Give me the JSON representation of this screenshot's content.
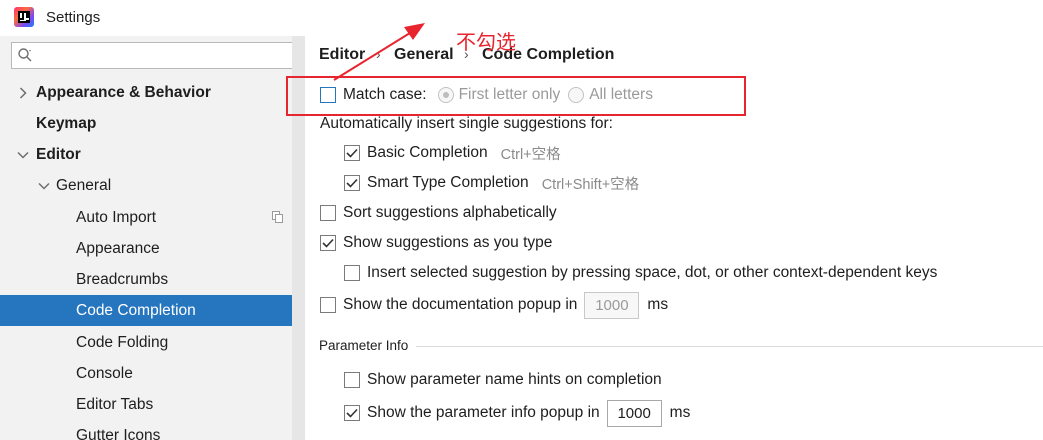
{
  "window": {
    "title": "Settings"
  },
  "sidebar": {
    "search_placeholder": "",
    "items": [
      {
        "label": "Appearance & Behavior",
        "level": 0,
        "expanded": false
      },
      {
        "label": "Keymap",
        "level": 0
      },
      {
        "label": "Editor",
        "level": 0,
        "expanded": true
      },
      {
        "label": "General",
        "level": 1,
        "expanded": true
      },
      {
        "label": "Auto Import",
        "level": 2
      },
      {
        "label": "Appearance",
        "level": 2
      },
      {
        "label": "Breadcrumbs",
        "level": 2
      },
      {
        "label": "Code Completion",
        "level": 2,
        "selected": true
      },
      {
        "label": "Code Folding",
        "level": 2
      },
      {
        "label": "Console",
        "level": 2
      },
      {
        "label": "Editor Tabs",
        "level": 2
      },
      {
        "label": "Gutter Icons",
        "level": 2
      }
    ]
  },
  "breadcrumb": [
    "Editor",
    "General",
    "Code Completion"
  ],
  "annotation": {
    "text": "不勾选",
    "color": "#e8252f"
  },
  "options": {
    "match_case": {
      "label": "Match case:",
      "checked": false
    },
    "first_letter_only": {
      "label": "First letter only",
      "selected": true,
      "enabled": false
    },
    "all_letters": {
      "label": "All letters",
      "selected": false,
      "enabled": false
    },
    "auto_insert_heading": "Automatically insert single suggestions for:",
    "basic_completion": {
      "label": "Basic Completion",
      "shortcut": "Ctrl+空格",
      "checked": true
    },
    "smart_type_completion": {
      "label": "Smart Type Completion",
      "shortcut": "Ctrl+Shift+空格",
      "checked": true
    },
    "sort_alpha": {
      "label": "Sort suggestions alphabetically",
      "checked": false
    },
    "show_as_you_type": {
      "label": "Show suggestions as you type",
      "checked": true
    },
    "insert_selected": {
      "label": "Insert selected suggestion by pressing space, dot, or other context-dependent keys",
      "checked": false
    },
    "show_doc_popup": {
      "label": "Show the documentation popup in",
      "value": "1000",
      "unit": "ms",
      "checked": false
    },
    "param_info_section": "Parameter Info",
    "param_name_hints": {
      "label": "Show parameter name hints on completion",
      "checked": false
    },
    "param_info_popup": {
      "label": "Show the parameter info popup in",
      "value": "1000",
      "unit": "ms",
      "checked": true
    }
  },
  "colors": {
    "accent": "#2675bf",
    "annotation": "#e8252f",
    "sidebar_bg": "#f2f2f2"
  }
}
